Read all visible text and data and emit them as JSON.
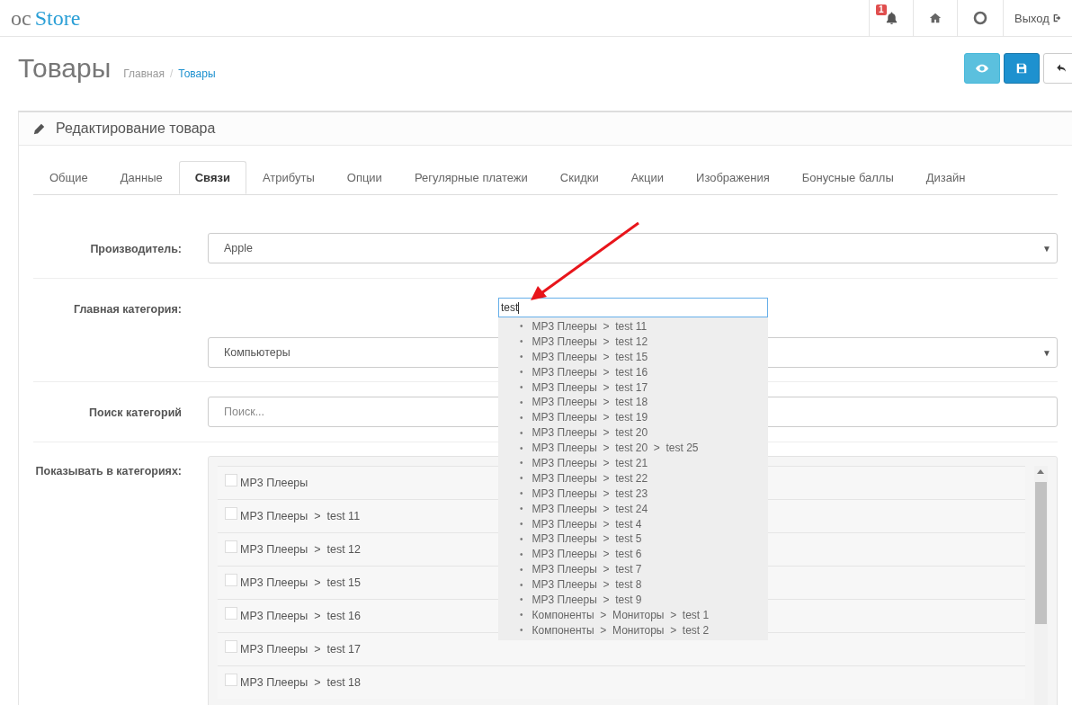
{
  "header": {
    "logo": {
      "part_1": "oc",
      "part_2": "Store"
    },
    "notifications_badge": "1",
    "logout": "Выход"
  },
  "page": {
    "title": "Товары",
    "breadcrumb_separator": "/",
    "breadcrumbs": [
      {
        "label": "Главная",
        "current": false
      },
      {
        "label": "Товары",
        "current": true
      }
    ]
  },
  "panel": {
    "title": "Редактирование товара"
  },
  "tabs": [
    {
      "label": "Общие",
      "selected": false
    },
    {
      "label": "Данные",
      "selected": false
    },
    {
      "label": "Связи",
      "selected": true
    },
    {
      "label": "Атрибуты",
      "selected": false
    },
    {
      "label": "Опции",
      "selected": false
    },
    {
      "label": "Регулярные платежи",
      "selected": false
    },
    {
      "label": "Скидки",
      "selected": false
    },
    {
      "label": "Акции",
      "selected": false
    },
    {
      "label": "Изображения",
      "selected": false
    },
    {
      "label": "Бонусные баллы",
      "selected": false
    },
    {
      "label": "Дизайн",
      "selected": false
    }
  ],
  "fields": [
    {
      "kind": "select",
      "label": "Производитель:",
      "value": "Apple",
      "caret": "▼"
    },
    {
      "kind": "autocomplete",
      "label": "Главная категория:",
      "value": "Компьютеры",
      "caret": "▼",
      "query": "test",
      "bullet": "•",
      "suggestions": [
        "MP3 Плееры  >  test 11",
        "MP3 Плееры  >  test 12",
        "MP3 Плееры  >  test 15",
        "MP3 Плееры  >  test 16",
        "MP3 Плееры  >  test 17",
        "MP3 Плееры  >  test 18",
        "MP3 Плееры  >  test 19",
        "MP3 Плееры  >  test 20",
        "MP3 Плееры  >  test 20  >  test 25",
        "MP3 Плееры  >  test 21",
        "MP3 Плееры  >  test 22",
        "MP3 Плееры  >  test 23",
        "MP3 Плееры  >  test 24",
        "MP3 Плееры  >  test 4",
        "MP3 Плееры  >  test 5",
        "MP3 Плееры  >  test 6",
        "MP3 Плееры  >  test 7",
        "MP3 Плееры  >  test 8",
        "MP3 Плееры  >  test 9",
        "Компоненты  >  Мониторы  >  test 1",
        "Компоненты  >  Мониторы  >  test 2"
      ]
    },
    {
      "kind": "search",
      "label": "Поиск категорий",
      "placeholder": "Поиск..."
    },
    {
      "kind": "checklist",
      "label": "Показывать в категориях:",
      "items": [
        {
          "label": "MP3 Плееры",
          "checked": false
        },
        {
          "label": "MP3 Плееры  >  test 11",
          "checked": false
        },
        {
          "label": "MP3 Плееры  >  test 12",
          "checked": false
        },
        {
          "label": "MP3 Плееры  >  test 15",
          "checked": false
        },
        {
          "label": "MP3 Плееры  >  test 16",
          "checked": false
        },
        {
          "label": "MP3 Плееры  >  test 17",
          "checked": false
        },
        {
          "label": "MP3 Плееры  >  test 18",
          "checked": false
        }
      ]
    }
  ]
}
